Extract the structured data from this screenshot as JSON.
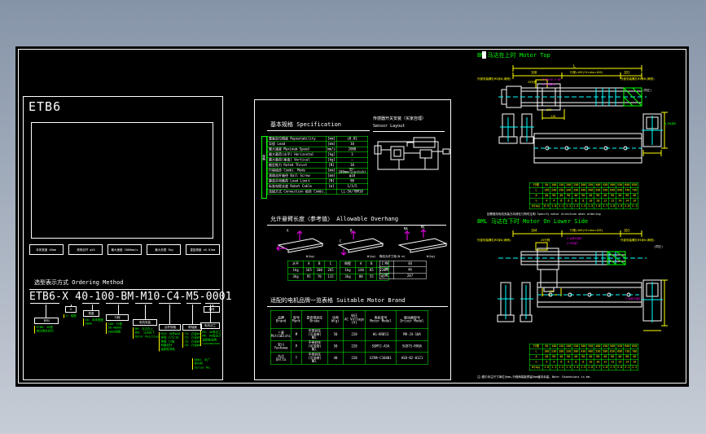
{
  "colors": {
    "bg_top": "#8694a8",
    "bg_bottom": "#c7cdd6",
    "sheet": "#000000",
    "line": "#ffffff",
    "green": "#00ff00",
    "yellow": "#ffff00",
    "cyan": "#00ffff",
    "magenta": "#ff00ff"
  },
  "left": {
    "title": "ETB6",
    "features": [
      "本体宽度 40mm",
      "滚珠丝杆 φ10",
      "最大速度 2000mm/s",
      "最大负载 3kg",
      "重复精度 ±0.01mm"
    ],
    "ordering_heading": "选型表示方式  Ordering  Method",
    "model_code": "ETB6-X 40-100-BM-M10-C4-M5-0001",
    "callouts": [
      {
        "box": "系列",
        "text": "ETB6: 40宽\n电动滑台系列"
      },
      {
        "box": "X",
        "text": "X: 轴型"
      },
      {
        "box": "宽度",
        "text": "40: 本体宽度\n40mm"
      },
      {
        "box": "行程",
        "text": "100: 行程\n50~400mm\n50mm间隔"
      },
      {
        "box": "电机安装",
        "text": "BM: 马达在上\nBML: 马达在下\nMotor Position"
      },
      {
        "box": "丝杆规格",
        "text": "M10: 丝杆φ10\n导程 2/5/10\n精度 C7级\n研磨丝杆\n高刚性导轨"
      },
      {
        "box": "联轴器",
        "text": "C4: 孔径φ4\nC5: 孔径φ5\nC6: 孔径φ6\nC8: 孔径φ8"
      },
      {
        "box": "电机法兰",
        "text": "M5: 40角法兰\nM6: 60角法兰\n适配各品牌\nCustomized"
      },
      {
        "box": "编号",
        "text": "0001: 出厂\n序列号\nSerial No."
      }
    ]
  },
  "spec": {
    "heading": "基本规格  Specification",
    "side": "规格",
    "grid": [
      [
        "重复定位精度 Repeatability",
        "[mm]",
        "±0.01"
      ],
      [
        "导程 Lead",
        "[mm]",
        "10"
      ],
      [
        "最大速度 Maximum Speed",
        "[mm/s]",
        "2000"
      ],
      [
        "最大载荷(水平) Horizontal",
        "[kg]",
        "3"
      ],
      [
        "最大载荷(垂直) Vertical",
        "[kg]",
        "—"
      ],
      [
        "额定推力 Rated Thrust",
        "[N]",
        "10"
      ],
      [
        "行程组合 Combi. Mode",
        "[mm]",
        "40-100mm/5(pitch)"
      ],
      [
        "滚珠丝杆轴径 Ball Screw",
        "[mm]",
        "φ10"
      ],
      [
        "静态许用载荷 Load Limit",
        "[N]",
        "90"
      ],
      [
        "标准电缆长度 Robot Cable",
        "[m]",
        "1/3/5"
      ],
      [
        "连接方式 Connection 组合 Combi.",
        "",
        "LL-5A/7BM10"
      ]
    ]
  },
  "sensor": {
    "heading_cn": "传感器开关安装〈买家自理〉",
    "heading_en": "Sensor  Layout"
  },
  "overhang": {
    "heading": "允许悬臂长度〈参考值〉  Allowable  Overhang",
    "marks": [
      "A",
      "B",
      "C",
      "MA",
      "MC"
    ],
    "captions": [
      "W(kg)",
      "W(kg)",
      "W(kg)"
    ],
    "table_h": [
      [
        "水平",
        "A",
        "B",
        "C"
      ],
      [
        "1kg",
        "165",
        "100",
        "265"
      ],
      [
        "3kg",
        "95",
        "70",
        "115"
      ]
    ],
    "table_v": [
      [
        "侧壁",
        "A",
        "B",
        "C"
      ],
      [
        "1kg",
        "140",
        "85",
        "220"
      ],
      [
        "3kg",
        "80",
        "55",
        "95"
      ]
    ],
    "moment_title": "静态允许力矩(N·m)",
    "moment": [
      [
        "MA",
        "40"
      ],
      [
        "MB",
        "46"
      ],
      [
        "MC",
        "287"
      ]
    ]
  },
  "brand": {
    "heading": "适配的电机品牌一览表格  Suitable  Motor  Brand",
    "grid": [
      [
        "品牌\nBrand",
        "型号\nMark",
        "是否带刹车\nBrake",
        "功率\nW(g)",
        "电压\nAC Voltage\n(V)",
        "电机型号\nMotor Model",
        "驱动器型号\nDriver Model"
      ],
      [
        "三菱\nMitsubishi",
        "M",
        "不带刹车\n(可选带)\nNO.",
        "50",
        "220",
        "HG-KR053",
        "MR-J4-10A"
      ],
      [
        "安川\nYaskawa",
        "P",
        "不带刹车\n(可选带)\nNO.",
        "50",
        "220",
        "SGM7J-A5A",
        "SGD7S-R90A"
      ],
      [
        "台达\nDelta",
        "T",
        "不带刹车\n(可选带)\nNO.",
        "40",
        "220",
        "ECMA-C10401",
        "ASD-B2-0121"
      ]
    ]
  },
  "motor_top": {
    "title": "BM 马达在上时 Motor Top",
    "dim_l": "L",
    "dim_a": "100",
    "dim_mid": "行程+105(Stroke+105)",
    "dim_b": "101",
    "note_left": "外部安装螺孔M3深6(两侧)",
    "note_right": "外部安装螺孔M3深6(两侧)",
    "same_left": "(同左)",
    "tap1": "P-M3×0.5 8F",
    "tap2": "4-M3深13",
    "stroke_note": "25行程",
    "dia": "φ20",
    "dim116": "116",
    "side_tap": "N-M4深6",
    "grid": [
      [
        "行程",
        "50",
        "100",
        "150",
        "200",
        "250",
        "300",
        "350",
        "400",
        "450",
        "500",
        "550",
        "600",
        "650"
      ],
      [
        "L",
        "196",
        "246",
        "296",
        "346",
        "396",
        "446",
        "496",
        "546",
        "596",
        "646",
        "696",
        "746",
        "796"
      ],
      [
        "A",
        "40",
        "90",
        "40",
        "90",
        "40",
        "90",
        "40",
        "90",
        "40",
        "90",
        "40",
        "90",
        "40"
      ],
      [
        "n",
        "4",
        "4",
        "6",
        "6",
        "8",
        "8",
        "10",
        "10",
        "12",
        "12",
        "14",
        "14",
        "16"
      ],
      [
        "W(kg)",
        "0.9",
        "1.0",
        "1.1",
        "1.2",
        "1.3",
        "1.4",
        "1.5",
        "1.6",
        "1.7",
        "1.8",
        "1.9",
        "2.0",
        "2.1"
      ]
    ]
  },
  "motor_bottom": {
    "note_above": "如需更改电机安装方向请在订购时注明 Specify motor direction when ordering",
    "title": "BML 马达在下时 Motor On Lower Side",
    "dim_a": "104",
    "dim_mid": "行程+105(Stroke+105)",
    "dim_b": "101",
    "note_left": "外部安装螺孔M3深6(两侧)",
    "note_right": "外部安装螺孔M3深6(两侧)",
    "same_left": "(同左)",
    "tap1": "2-φ3H7深4",
    "tap2": "4-M3深7",
    "stroke_note": "25行程",
    "dim116": "116",
    "side_tap": "2-φ3H7深4",
    "grid": [
      [
        "行程",
        "50",
        "100",
        "150",
        "200",
        "250",
        "300",
        "350",
        "400",
        "450",
        "500",
        "550",
        "600",
        "650"
      ],
      [
        "L",
        "186",
        "236",
        "286",
        "336",
        "386",
        "436",
        "486",
        "536",
        "586",
        "636",
        "686",
        "736",
        "786"
      ],
      [
        "A",
        "40",
        "90",
        "40",
        "90",
        "40",
        "90",
        "40",
        "90",
        "40",
        "90",
        "40",
        "90",
        "40"
      ],
      [
        "n",
        "4",
        "4",
        "6",
        "6",
        "8",
        "8",
        "10",
        "10",
        "12",
        "12",
        "14",
        "14",
        "16"
      ],
      [
        "W(kg)",
        "1.0",
        "1.1",
        "1.2",
        "1.3",
        "1.4",
        "1.5",
        "1.6",
        "1.7",
        "1.8",
        "1.9",
        "2.0",
        "2.1",
        "2.2"
      ]
    ]
  },
  "footnote": "注:图中未注尺寸单位为mm,行程两端各预留5mm缓冲余量。Note: Dimensions in mm."
}
